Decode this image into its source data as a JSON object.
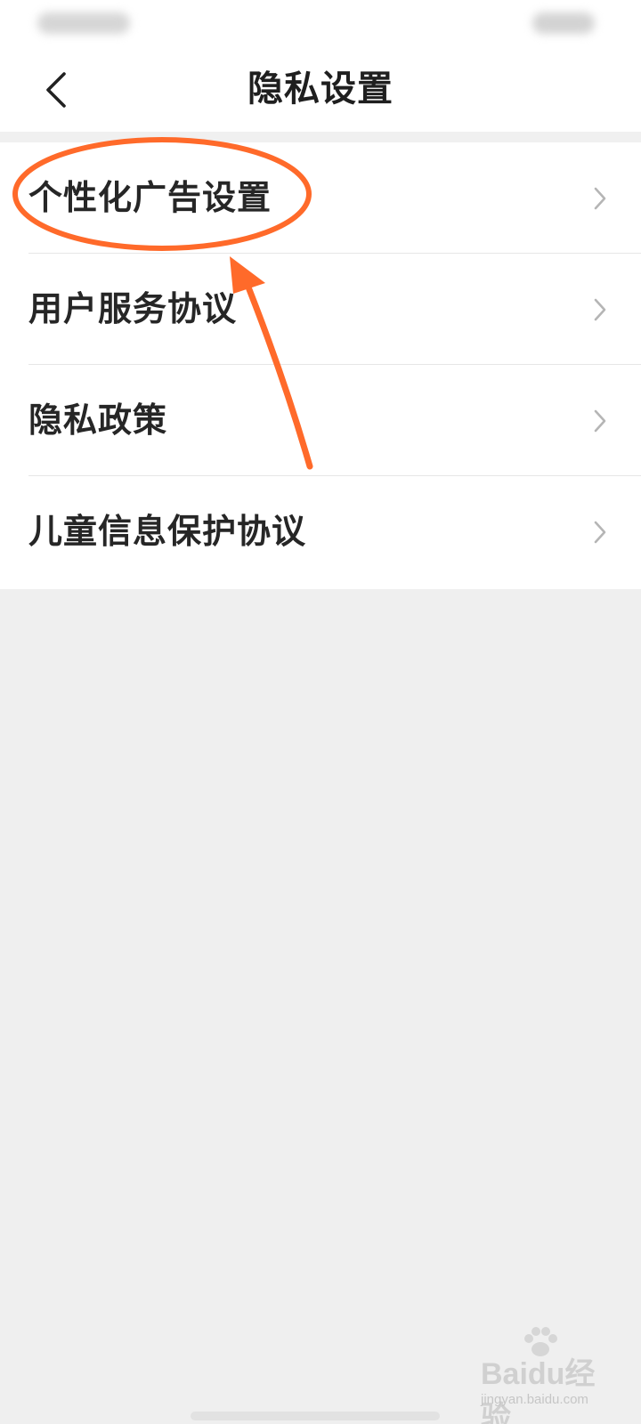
{
  "nav": {
    "title": "隐私设置",
    "back_icon": "chevron-left-icon"
  },
  "menu": {
    "items": [
      {
        "label": "个性化广告设置",
        "icon": "chevron-right-icon"
      },
      {
        "label": "用户服务协议",
        "icon": "chevron-right-icon"
      },
      {
        "label": "隐私政策",
        "icon": "chevron-right-icon"
      },
      {
        "label": "儿童信息保护协议",
        "icon": "chevron-right-icon"
      }
    ]
  },
  "annotation": {
    "color": "#ff6a2a",
    "shapes": [
      "ellipse-highlight",
      "arrow"
    ]
  },
  "watermark": {
    "brand": "Baidu经验",
    "site": "jingyan.baidu.com"
  },
  "colors": {
    "background": "#efefef",
    "surface": "#ffffff",
    "text": "#262626",
    "chevron": "#b5b5b5",
    "annotation": "#ff6a2a"
  }
}
